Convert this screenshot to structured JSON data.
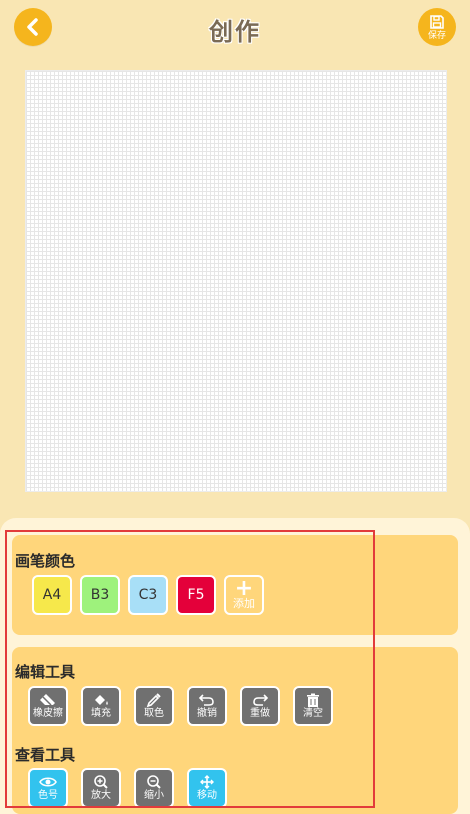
{
  "header": {
    "title": "创作",
    "save_label": "保存",
    "back_icon": "chevron-left-icon",
    "save_icon": "floppy-disk-icon"
  },
  "colors": {
    "section_title": "画笔颜色",
    "swatches": [
      {
        "label": "A4",
        "color": "#F6E84B"
      },
      {
        "label": "B3",
        "color": "#9EF27C"
      },
      {
        "label": "C3",
        "color": "#A8DFF7"
      },
      {
        "label": "F5",
        "color": "#E4003A"
      }
    ],
    "add_label": "添加"
  },
  "edit_tools": {
    "section_title": "编辑工具",
    "items": [
      {
        "label": "橡皮擦",
        "icon": "eraser-icon"
      },
      {
        "label": "填充",
        "icon": "paint-bucket-icon"
      },
      {
        "label": "取色",
        "icon": "eyedropper-icon"
      },
      {
        "label": "撤销",
        "icon": "undo-icon"
      },
      {
        "label": "重做",
        "icon": "redo-icon"
      },
      {
        "label": "清空",
        "icon": "trash-icon"
      }
    ]
  },
  "view_tools": {
    "section_title": "查看工具",
    "items": [
      {
        "label": "色号",
        "icon": "eye-icon"
      },
      {
        "label": "放大",
        "icon": "zoom-in-icon"
      },
      {
        "label": "缩小",
        "icon": "zoom-out-icon"
      },
      {
        "label": "移动",
        "icon": "move-icon"
      }
    ]
  },
  "theme": {
    "accent": "#F5B51D",
    "card": "#FFD67B",
    "tool_gray": "#707070",
    "tool_blue": "#32C3EE",
    "highlight": "#E23B3B"
  }
}
